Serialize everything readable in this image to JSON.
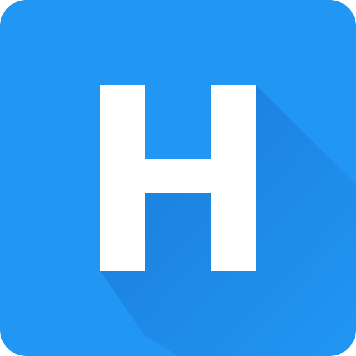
{
  "icon": {
    "name": "h-letter-app-icon",
    "letter": "H",
    "colors": {
      "background": "#2196F3",
      "shadow": "#1565C0",
      "glyph": "#FFFFFF"
    }
  }
}
